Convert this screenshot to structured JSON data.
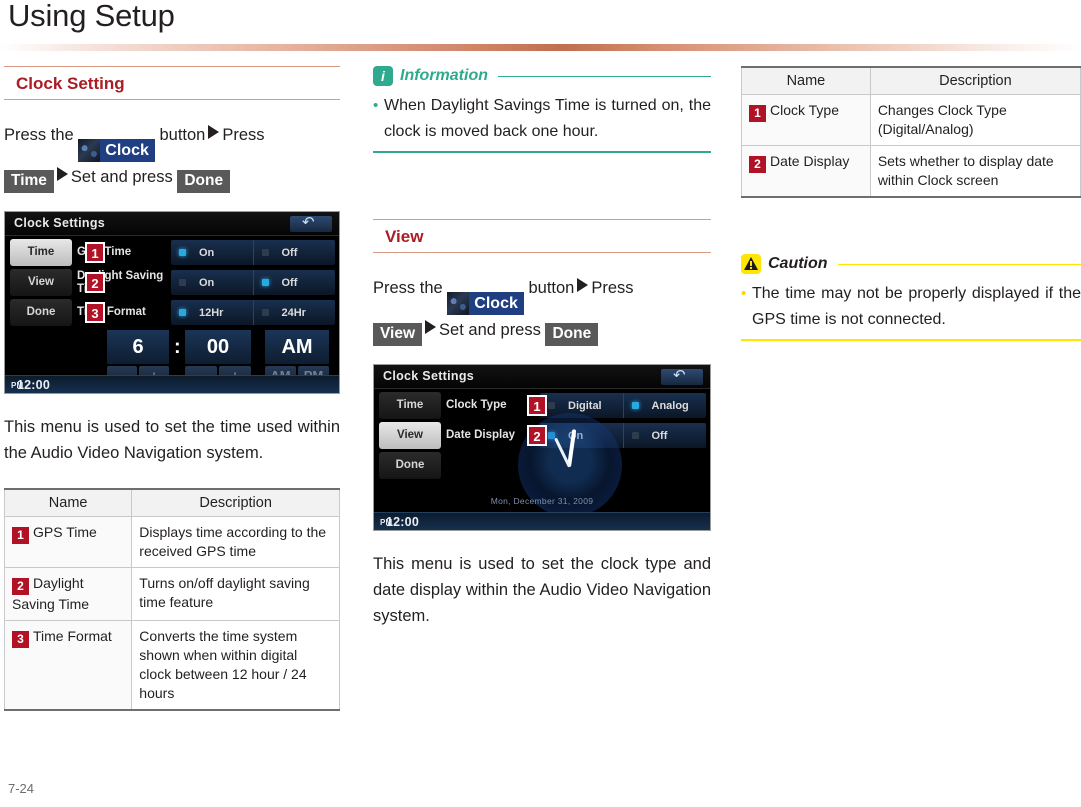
{
  "page": {
    "title": "Using Setup",
    "folio": "7-24",
    "accent_red": "#aa1d24",
    "accent_badge": "#b11226",
    "accent_info": "#2faa8e",
    "accent_caution": "#ffe500"
  },
  "col1": {
    "section_title": "Clock Setting",
    "instruction": {
      "pre": "Press the",
      "clock_label": "Clock",
      "mid1": "button",
      "press": "Press",
      "tab_label": "Time",
      "mid2": "Set and press",
      "done_label": "Done"
    },
    "screenshot": {
      "header_title": "Clock Settings",
      "back_icon": "back-arrow-icon",
      "side_buttons": [
        "Time",
        "View",
        "Done"
      ],
      "active_side_button": "Time",
      "rows": [
        {
          "badge": "1",
          "label": "GPS Time",
          "options": [
            {
              "label": "On",
              "selected": true
            },
            {
              "label": "Off",
              "selected": false
            }
          ]
        },
        {
          "badge": "2",
          "label": "Daylight Saving Time",
          "options": [
            {
              "label": "On",
              "selected": false
            },
            {
              "label": "Off",
              "selected": true
            }
          ]
        },
        {
          "badge": "3",
          "label": "Time Format",
          "options": [
            {
              "label": "12Hr",
              "selected": true
            },
            {
              "label": "24Hr",
              "selected": false
            }
          ]
        }
      ],
      "picker": {
        "hour": "6",
        "colon": ":",
        "minute": "00",
        "meridiem": "AM",
        "hour_minus": "–",
        "hour_plus": "+",
        "minute_minus": "–",
        "minute_plus": "+",
        "am_label": "AM",
        "pm_label": "PM"
      },
      "status_time": "12:00",
      "status_meridiem": "PM"
    },
    "paragraph": "This menu is used to set the time used within the Audio Video Navigation system.",
    "table": {
      "headers": [
        "Name",
        "Description"
      ],
      "rows": [
        {
          "num": "1",
          "name": "GPS Time",
          "desc": "Displays time according to the received GPS time"
        },
        {
          "num": "2",
          "name": "Daylight Saving Time",
          "desc": "Turns on/off daylight saving time feature"
        },
        {
          "num": "3",
          "name": "Time Format",
          "desc": "Converts the time system shown when within digital clock between 12 hour / 24 hours"
        }
      ]
    }
  },
  "col2": {
    "info": {
      "icon": "info-icon",
      "title": "Information",
      "bullet": "•",
      "text": "When Daylight Savings Time is turned on, the clock is moved back one hour."
    },
    "section_title": "View",
    "instruction": {
      "pre": "Press the",
      "clock_label": "Clock",
      "mid1": "button",
      "press": "Press",
      "tab_label": "View",
      "mid2": "Set and press",
      "done_label": "Done"
    },
    "screenshot": {
      "header_title": "Clock Settings",
      "back_icon": "back-arrow-icon",
      "side_buttons": [
        "Time",
        "View",
        "Done"
      ],
      "active_side_button": "View",
      "rows": [
        {
          "badge": "1",
          "label": "Clock Type",
          "options": [
            {
              "label": "Digital",
              "selected": false
            },
            {
              "label": "Analog",
              "selected": true
            }
          ]
        },
        {
          "badge": "2",
          "label": "Date Display",
          "options": [
            {
              "label": "On",
              "selected": true
            },
            {
              "label": "Off",
              "selected": false
            }
          ]
        }
      ],
      "clock_date": "Mon, December 31, 2009",
      "status_time": "12:00",
      "status_meridiem": "PM"
    },
    "paragraph": "This menu is used to set the clock type and date display within the Audio Video Navigation system."
  },
  "col3": {
    "table": {
      "headers": [
        "Name",
        "Description"
      ],
      "rows": [
        {
          "num": "1",
          "name": "Clock Type",
          "desc": "Changes Clock Type (Digital/Analog)"
        },
        {
          "num": "2",
          "name": "Date Display",
          "desc": "Sets whether to display date within Clock screen"
        }
      ]
    },
    "caution": {
      "icon": "warning-icon",
      "title": "Caution",
      "bullet": "•",
      "text": "The time may not be properly displayed if the GPS time is not connected."
    }
  }
}
